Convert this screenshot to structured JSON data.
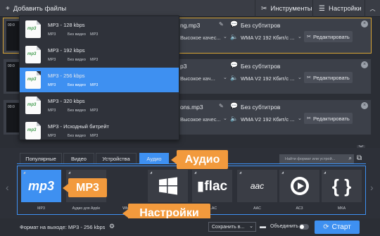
{
  "toolbar": {
    "add_files": "Добавить файлы",
    "tools": "Инструменты",
    "settings": "Настройки"
  },
  "files": [
    {
      "thumb_time": "00:0",
      "name": "ng.mp3",
      "quality": "Высокое качес...",
      "subtitles": "Без субтитров",
      "audio": "WMA V2 192 Кбит/с ...",
      "edit": "Редактировать",
      "selected": true
    },
    {
      "thumb_time": "00:0",
      "name": "p3",
      "quality": "Высокое кач...",
      "subtitles": "Без субтитров",
      "audio": "WMA V2 192 Кбит/с ...",
      "edit": "Редактировать",
      "selected": false
    },
    {
      "thumb_time": "00:0",
      "name": "ons.mp3",
      "quality": "Высокое качес...",
      "subtitles": "Без субтитров",
      "audio": "WMA V2 192 Кбит/с ...",
      "edit": "Редактировать",
      "selected": false
    }
  ],
  "dropdown": {
    "items": [
      {
        "title": "MP3 - 128 kbps",
        "c1": "MP3",
        "c2": "Без видео",
        "c3": "MP3",
        "highlighted": false
      },
      {
        "title": "MP3 - 192 kbps",
        "c1": "MP3",
        "c2": "Без видео",
        "c3": "MP3",
        "highlighted": false
      },
      {
        "title": "MP3 - 256 kbps",
        "c1": "MP3",
        "c2": "Без видео",
        "c3": "MP3",
        "highlighted": true
      },
      {
        "title": "MP3 - 320 kbps",
        "c1": "MP3",
        "c2": "Без видео",
        "c3": "MP3",
        "highlighted": false
      },
      {
        "title": "MP3 - Исходный битрейт",
        "c1": "MP3",
        "c2": "Без видео",
        "c3": "MP3",
        "highlighted": false
      }
    ]
  },
  "tabs": [
    "Популярные",
    "Видео",
    "Устройства",
    "Аудио"
  ],
  "active_tab": "Аудио",
  "search_placeholder": "Найти формат или устрой...",
  "formats": [
    {
      "label": "MP3",
      "icon": "mp3-icon"
    },
    {
      "label": "Аудио для Apple",
      "icon": "apple-music-icon"
    },
    {
      "label": "WMA",
      "icon": "windows-icon"
    },
    {
      "label": "FLAC",
      "icon": "flac-icon"
    },
    {
      "label": "AAC",
      "icon": "aac-icon"
    },
    {
      "label": "AC3",
      "icon": "ac3-icon"
    },
    {
      "label": "MKA",
      "icon": "mka-icon"
    }
  ],
  "callouts": {
    "audio": "Аудио",
    "mp3": "MP3",
    "settings": "Настройки"
  },
  "status": {
    "output_format": "Формат на выходе: MP3 - 256 kbps",
    "save_to": "Сохранить в...",
    "merge": "Объединить",
    "start": "Старт"
  },
  "colors": {
    "accent": "#3e90f1",
    "callout": "#f29a3d",
    "selected_border": "#d6a437"
  }
}
